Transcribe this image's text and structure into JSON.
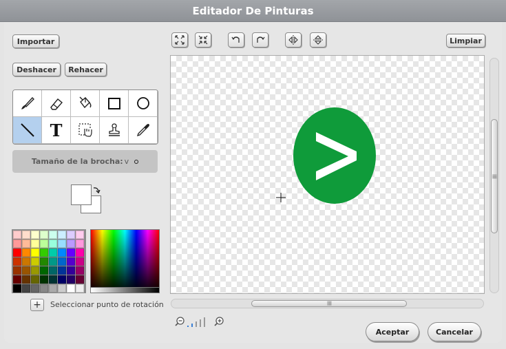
{
  "window": {
    "title": "Editador De Pinturas"
  },
  "left_panel": {
    "import_label": "Importar",
    "undo_label": "Deshacer",
    "redo_label": "Rehacer",
    "brush_size_label": "Tamaño de la brocha:",
    "brush_size_chevron": "v",
    "rotation_label": "Seleccionar punto de rotación",
    "rotation_icon": "+"
  },
  "tools": [
    {
      "name": "paintbrush",
      "selected": false
    },
    {
      "name": "eraser",
      "selected": false
    },
    {
      "name": "fill-bucket",
      "selected": false
    },
    {
      "name": "rectangle",
      "selected": false
    },
    {
      "name": "ellipse",
      "selected": false
    },
    {
      "name": "line",
      "selected": true
    },
    {
      "name": "text",
      "selected": false,
      "glyph": "T"
    },
    {
      "name": "select",
      "selected": false
    },
    {
      "name": "stamp",
      "selected": false
    },
    {
      "name": "eyedropper",
      "selected": false
    }
  ],
  "top_toolbar": {
    "icons": [
      "grow-icon",
      "shrink-icon",
      "rotate-ccw-icon",
      "rotate-cw-icon",
      "flip-horizontal-icon",
      "flip-vertical-icon"
    ],
    "clear_label": "Limpiar"
  },
  "colors": {
    "foreground": "#ffffff",
    "background": "#ffffff",
    "sprite_green": "#0f9b3a",
    "palette": [
      "#ffcccc",
      "#ffddcc",
      "#ffffcc",
      "#ddffcc",
      "#ccffee",
      "#cceeff",
      "#ddccff",
      "#ffccee",
      "#ff9999",
      "#ffbb99",
      "#ffff99",
      "#bbff99",
      "#99ffdd",
      "#99ddff",
      "#bb99ff",
      "#ff99dd",
      "#ff0000",
      "#ff8800",
      "#ffff00",
      "#33cc00",
      "#00ccaa",
      "#0088ff",
      "#6600ff",
      "#ff00aa",
      "#cc3300",
      "#cc7700",
      "#cccc00",
      "#228800",
      "#009988",
      "#0066cc",
      "#5500cc",
      "#cc0088",
      "#993300",
      "#995500",
      "#999900",
      "#006600",
      "#006666",
      "#003399",
      "#330099",
      "#990066",
      "#660000",
      "#663300",
      "#666600",
      "#003300",
      "#003333",
      "#000066",
      "#220066",
      "#660033",
      "#000000",
      "#444444",
      "#666666",
      "#888888",
      "#aaaaaa",
      "#cccccc",
      "#ffffff",
      "#eeeeee"
    ]
  },
  "footer": {
    "accept_label": "Aceptar",
    "cancel_label": "Cancelar"
  }
}
